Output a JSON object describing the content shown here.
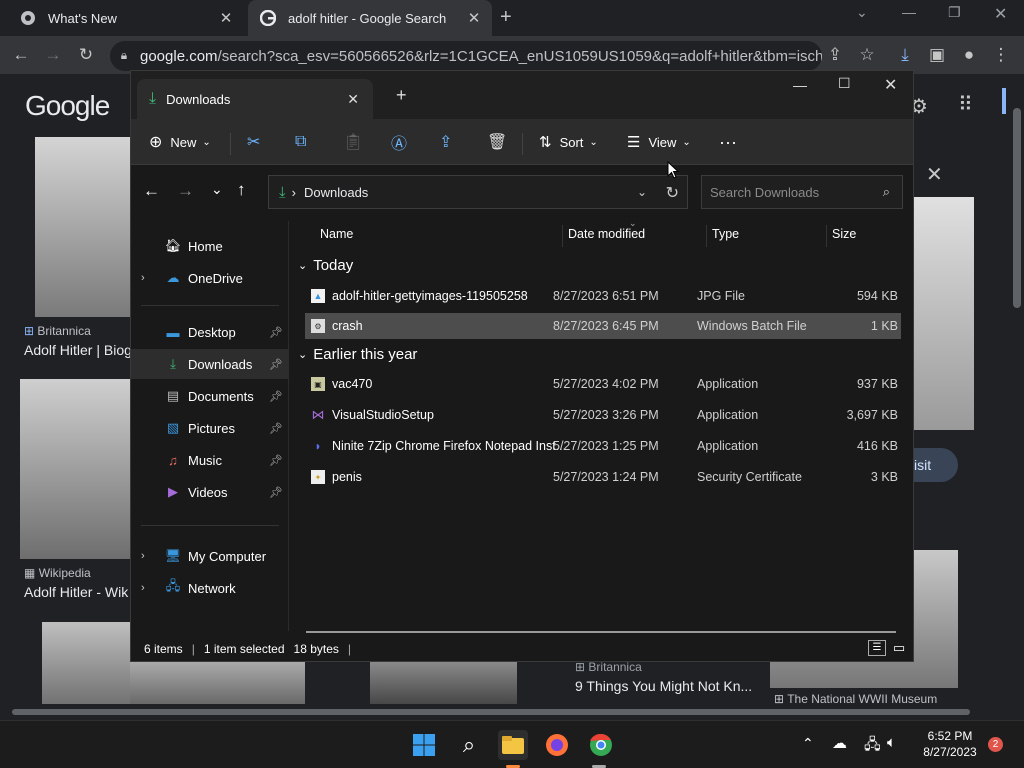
{
  "chrome": {
    "tabs": [
      {
        "title": "What's New"
      },
      {
        "title": "adolf hitler - Google Search"
      }
    ],
    "url_domain": "google.com",
    "url_rest": "/search?sca_esv=560566526&rlz=1C1GCEA_enUS1059US1059&q=adolf+hitler&tbm=isch&sou..."
  },
  "google": {
    "logo": "Google",
    "results": [
      {
        "source": "Britannica",
        "title": "Adolf Hitler | Biog"
      },
      {
        "source": "Wikipedia",
        "title": "Adolf Hitler - Wik"
      },
      {
        "source": "Britannica",
        "title": "9 Things You Might Not Kn..."
      },
      {
        "source": "",
        "title": "The National WWII Museum"
      }
    ],
    "visit_label": "isit"
  },
  "explorer": {
    "tab_title": "Downloads",
    "commands": {
      "new": "New",
      "sort": "Sort",
      "view": "View"
    },
    "path": "Downloads",
    "search_placeholder": "Search Downloads",
    "nav": [
      {
        "label": "Home"
      },
      {
        "label": "OneDrive"
      },
      {
        "label": "Desktop"
      },
      {
        "label": "Downloads"
      },
      {
        "label": "Documents"
      },
      {
        "label": "Pictures"
      },
      {
        "label": "Music"
      },
      {
        "label": "Videos"
      },
      {
        "label": "My Computer"
      },
      {
        "label": "Network"
      }
    ],
    "columns": {
      "name": "Name",
      "date": "Date modified",
      "type": "Type",
      "size": "Size"
    },
    "groups": [
      {
        "label": "Today",
        "files": [
          {
            "name": "adolf-hitler-gettyimages-119505258",
            "date": "8/27/2023 6:51 PM",
            "type": "JPG File",
            "size": "594 KB"
          },
          {
            "name": "crash",
            "date": "8/27/2023 6:45 PM",
            "type": "Windows Batch File",
            "size": "1 KB"
          }
        ]
      },
      {
        "label": "Earlier this year",
        "files": [
          {
            "name": "vac470",
            "date": "5/27/2023 4:02 PM",
            "type": "Application",
            "size": "937 KB"
          },
          {
            "name": "VisualStudioSetup",
            "date": "5/27/2023 3:26 PM",
            "type": "Application",
            "size": "3,697 KB"
          },
          {
            "name": "Ninite 7Zip Chrome Firefox Notepad Inst...",
            "date": "5/27/2023 1:25 PM",
            "type": "Application",
            "size": "416 KB"
          },
          {
            "name": "penis",
            "date": "5/27/2023 1:24 PM",
            "type": "Security Certificate",
            "size": "3 KB"
          }
        ]
      }
    ],
    "status": {
      "items": "6 items",
      "selected": "1 item selected",
      "bytes": "18 bytes"
    }
  },
  "taskbar": {
    "time": "6:52 PM",
    "date": "8/27/2023",
    "notification_count": "2"
  },
  "colors": {
    "accent": "#0078d4",
    "selected_row": "#4d4d4d",
    "folder": "#f4c542"
  }
}
